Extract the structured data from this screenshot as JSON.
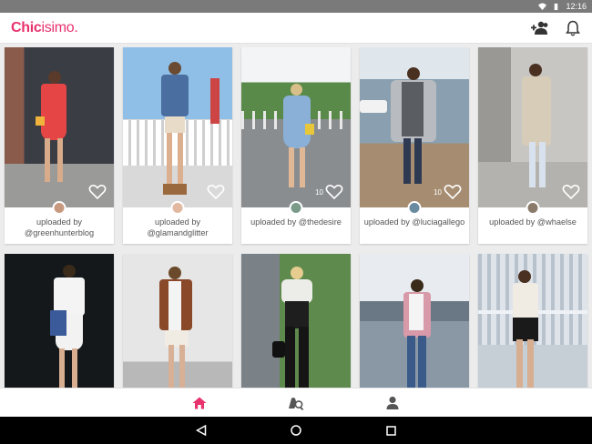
{
  "status": {
    "time": "12:16"
  },
  "app": {
    "logo_bold": "Chic",
    "logo_light": "isimo.",
    "brand_color": "#e8326e"
  },
  "actions": {
    "add_friends_icon": "add-people-icon",
    "notifications_icon": "bell-icon"
  },
  "cards": [
    {
      "uploader_line1": "uploaded by",
      "uploader_line2": "@greenhunterblog",
      "likes": ""
    },
    {
      "uploader_line1": "uploaded by",
      "uploader_line2": "@glamandglitter",
      "likes": ""
    },
    {
      "uploader_line1": "uploaded by @thedesire",
      "uploader_line2": "",
      "likes": "10"
    },
    {
      "uploader_line1": "uploaded by @luciagallego",
      "uploader_line2": "",
      "likes": "10"
    },
    {
      "uploader_line1": "uploaded by @whaelse",
      "uploader_line2": "",
      "likes": ""
    }
  ],
  "bottom_nav": {
    "home": "home-icon",
    "search": "search-icon",
    "profile": "profile-icon"
  },
  "system_nav": {
    "back": "back-icon",
    "home": "home-circle-icon",
    "recents": "recents-icon"
  }
}
